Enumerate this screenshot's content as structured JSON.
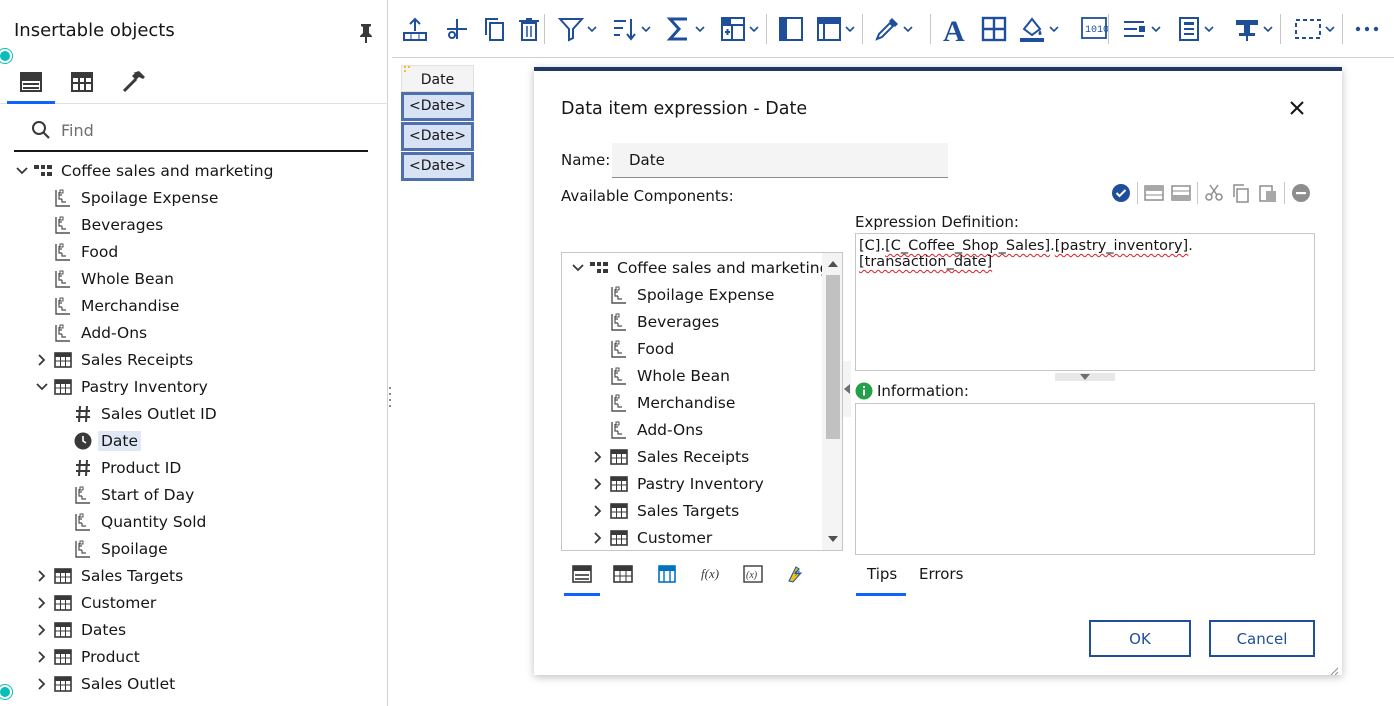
{
  "left_panel": {
    "title": "Insertable objects",
    "tabs": [
      {
        "icon": "data-source-icon",
        "active": true
      },
      {
        "icon": "toolbox-icon",
        "active": false
      },
      {
        "icon": "hammer-icon",
        "active": false
      }
    ],
    "search": {
      "placeholder": "Find",
      "value": ""
    },
    "tree": [
      {
        "label": "Coffee sales and marketing",
        "icon": "package-icon",
        "level": 0,
        "expander": "down"
      },
      {
        "label": "Spoilage Expense",
        "icon": "hierarchy-icon",
        "level": 1,
        "expander": "none"
      },
      {
        "label": "Beverages",
        "icon": "hierarchy-icon",
        "level": 1,
        "expander": "none"
      },
      {
        "label": "Food",
        "icon": "hierarchy-icon",
        "level": 1,
        "expander": "none"
      },
      {
        "label": "Whole Bean",
        "icon": "hierarchy-icon",
        "level": 1,
        "expander": "none"
      },
      {
        "label": "Merchandise",
        "icon": "hierarchy-icon",
        "level": 1,
        "expander": "none"
      },
      {
        "label": "Add-Ons",
        "icon": "hierarchy-icon",
        "level": 1,
        "expander": "none"
      },
      {
        "label": "Sales Receipts",
        "icon": "table-icon",
        "level": 1,
        "expander": "right"
      },
      {
        "label": "Pastry Inventory",
        "icon": "table-icon",
        "level": 1,
        "expander": "down"
      },
      {
        "label": "Sales Outlet ID",
        "icon": "hash-icon",
        "level": 2,
        "expander": "none"
      },
      {
        "label": "Date",
        "icon": "clock-icon",
        "level": 2,
        "expander": "none",
        "selected": true
      },
      {
        "label": "Product ID",
        "icon": "hash-icon",
        "level": 2,
        "expander": "none"
      },
      {
        "label": "Start of Day",
        "icon": "hierarchy-icon",
        "level": 2,
        "expander": "none"
      },
      {
        "label": "Quantity Sold",
        "icon": "hierarchy-icon",
        "level": 2,
        "expander": "none"
      },
      {
        "label": "Spoilage",
        "icon": "hierarchy-icon",
        "level": 2,
        "expander": "none"
      },
      {
        "label": "Sales Targets",
        "icon": "table-icon",
        "level": 1,
        "expander": "right"
      },
      {
        "label": "Customer",
        "icon": "table-icon",
        "level": 1,
        "expander": "right"
      },
      {
        "label": "Dates",
        "icon": "table-icon",
        "level": 1,
        "expander": "right"
      },
      {
        "label": "Product",
        "icon": "table-icon",
        "level": 1,
        "expander": "right"
      },
      {
        "label": "Sales Outlet",
        "icon": "table-icon",
        "level": 1,
        "expander": "right"
      }
    ]
  },
  "toolbar": {
    "items": [
      "insert-above-icon",
      "cut-icon",
      "copy-icon",
      "delete-icon",
      "filter-icon",
      "sort-icon",
      "summarize-icon",
      "group-icon",
      "section-icon",
      "header-icon",
      "eyedropper-icon",
      "font-icon",
      "borders-icon",
      "fill-color-icon",
      "data-format-icon",
      "align-icon",
      "page-icon",
      "pin-toolbar-icon",
      "select-icon",
      "more-icon"
    ]
  },
  "list": {
    "header": "Date",
    "cells": [
      "<Date>",
      "<Date>",
      "<Date>"
    ]
  },
  "dialog": {
    "title": "Data item expression - Date",
    "name_label": "Name:",
    "name_value": "Date",
    "available_label": "Available Components:",
    "expression_label": "Expression Definition:",
    "expression_parts": [
      "[C].",
      "[C_Coffee_Shop_Sales]",
      ".",
      "[pastry_inventory]",
      ".",
      "[transaction_date]"
    ],
    "information_label": "Information:",
    "component_tree": [
      {
        "label": "Coffee sales and marketing",
        "icon": "package-icon",
        "level": 0,
        "expander": "down"
      },
      {
        "label": "Spoilage Expense",
        "icon": "hierarchy-icon",
        "level": 1,
        "expander": "none"
      },
      {
        "label": "Beverages",
        "icon": "hierarchy-icon",
        "level": 1,
        "expander": "none"
      },
      {
        "label": "Food",
        "icon": "hierarchy-icon",
        "level": 1,
        "expander": "none"
      },
      {
        "label": "Whole Bean",
        "icon": "hierarchy-icon",
        "level": 1,
        "expander": "none"
      },
      {
        "label": "Merchandise",
        "icon": "hierarchy-icon",
        "level": 1,
        "expander": "none"
      },
      {
        "label": "Add-Ons",
        "icon": "hierarchy-icon",
        "level": 1,
        "expander": "none"
      },
      {
        "label": "Sales Receipts",
        "icon": "table-icon",
        "level": 1,
        "expander": "right"
      },
      {
        "label": "Pastry Inventory",
        "icon": "table-icon",
        "level": 1,
        "expander": "right"
      },
      {
        "label": "Sales Targets",
        "icon": "table-icon",
        "level": 1,
        "expander": "right"
      },
      {
        "label": "Customer",
        "icon": "table-icon",
        "level": 1,
        "expander": "right"
      }
    ],
    "component_tabs": [
      {
        "icon": "data-source-icon",
        "active": true
      },
      {
        "icon": "query-icon",
        "active": false
      },
      {
        "icon": "data-items-icon",
        "active": false
      },
      {
        "icon": "functions-icon",
        "active": false
      },
      {
        "icon": "parameters-icon",
        "active": false
      },
      {
        "icon": "macros-icon",
        "active": false
      }
    ],
    "info_tabs": [
      {
        "label": "Tips",
        "active": true
      },
      {
        "label": "Errors",
        "active": false
      }
    ],
    "ok_label": "OK",
    "cancel_label": "Cancel"
  },
  "colors": {
    "accent": "#0f62fe",
    "toolbar_icon": "#1f4f9a",
    "dialog_border": "#1f3864",
    "list_cell_bg": "#d7e3f4",
    "list_cell_border": "#4f6fad",
    "status_dot": "#08bdba"
  }
}
